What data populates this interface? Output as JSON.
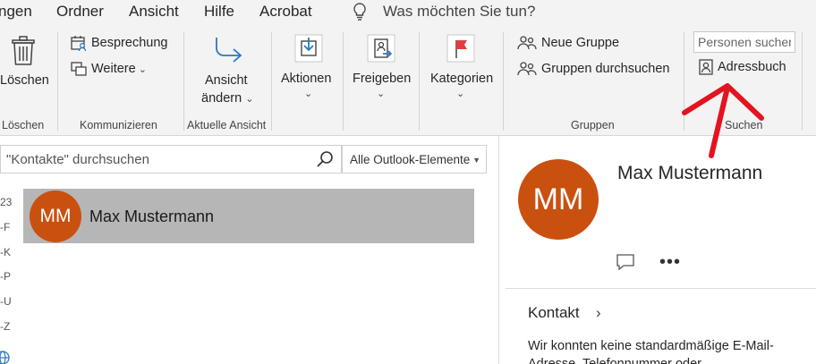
{
  "menu": {
    "items": [
      "ngen",
      "Ordner",
      "Ansicht",
      "Hilfe",
      "Acrobat"
    ],
    "tell_me": "Was möchten Sie tun?"
  },
  "ribbon": {
    "loeschen": {
      "button": "Löschen",
      "group": "Löschen"
    },
    "kommunizieren": {
      "besprechung": "Besprechung",
      "weitere": "Weitere",
      "group": "Kommunizieren"
    },
    "ansicht": {
      "line1": "Ansicht",
      "line2": "ändern",
      "group": "Aktuelle Ansicht"
    },
    "aktionen": {
      "label": "Aktionen"
    },
    "freigeben": {
      "label": "Freigeben"
    },
    "kategorien": {
      "label": "Kategorien"
    },
    "gruppen": {
      "neue_gruppe": "Neue Gruppe",
      "durchsuchen": "Gruppen durchsuchen",
      "group": "Gruppen"
    },
    "suchen": {
      "placeholder": "Personen suchen",
      "adressbuch": "Adressbuch",
      "group": "Suchen"
    }
  },
  "search": {
    "placeholder": "\"Kontakte\" durchsuchen",
    "scope": "Alle Outlook-Elemente"
  },
  "alpha_index": [
    "23",
    "-F",
    "-K",
    "-P",
    "-U",
    "-Z"
  ],
  "contacts": [
    {
      "initials": "MM",
      "name": "Max Mustermann"
    }
  ],
  "detail": {
    "initials": "MM",
    "name": "Max Mustermann",
    "more": "•••",
    "section_title": "Kontakt",
    "section_chevron": "›",
    "message": "Wir konnten keine standardmäßige E-Mail-Adresse, Telefonnummer oder"
  },
  "colors": {
    "avatar": "#ca5010",
    "selected_row": "#b6b6b6",
    "ribbon_bg": "#f3f3f3",
    "annotation": "#e3141f"
  }
}
